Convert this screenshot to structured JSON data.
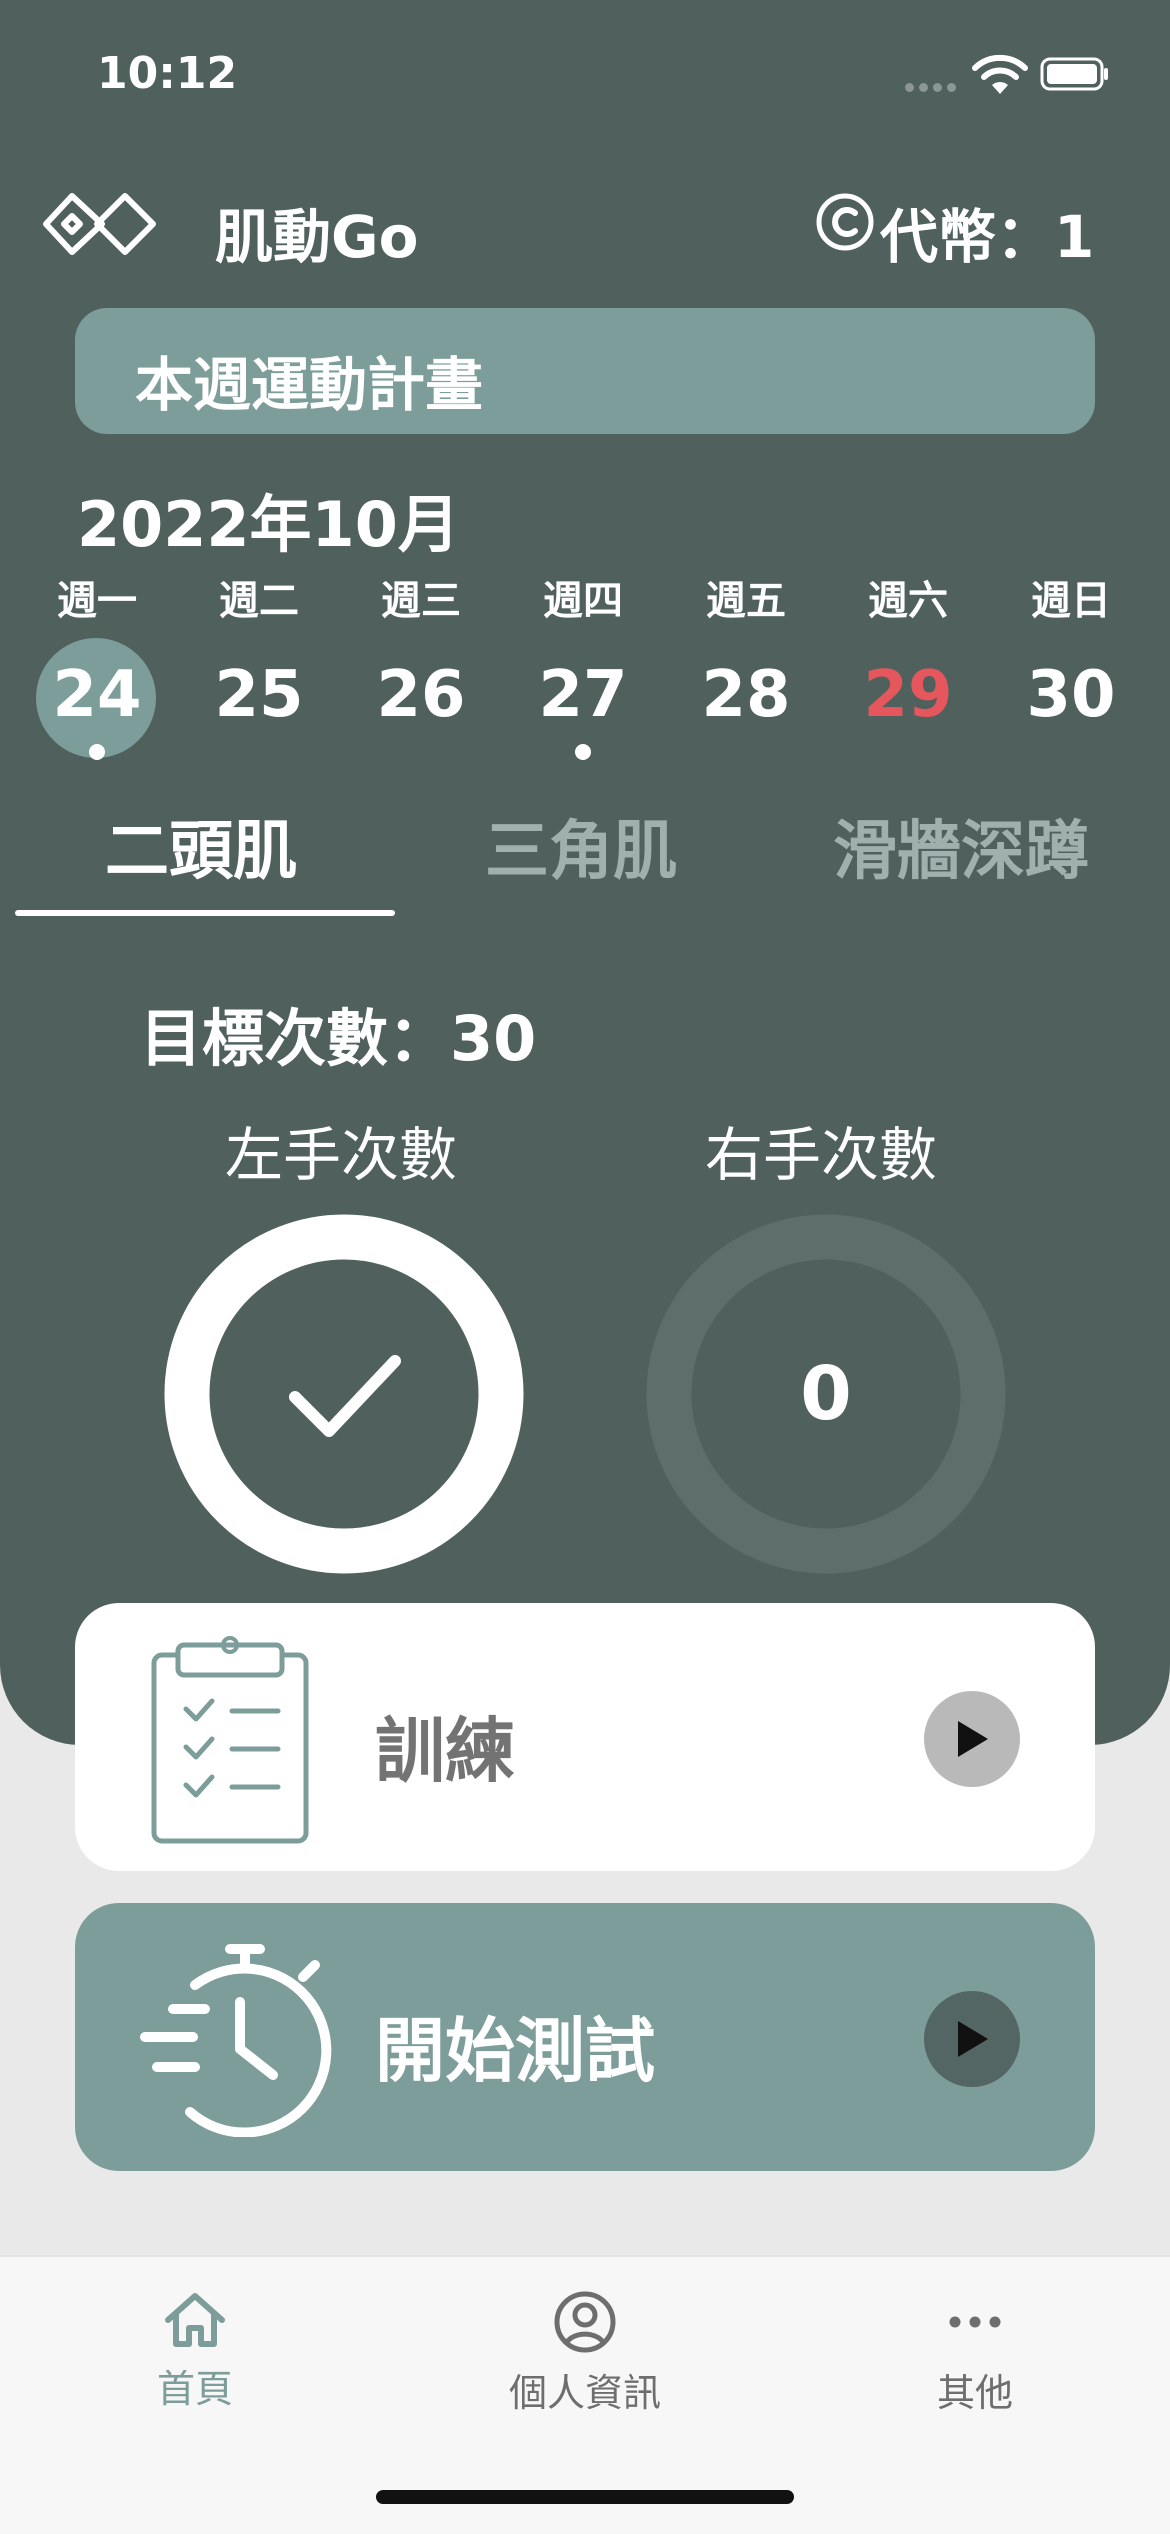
{
  "status_bar": {
    "time": "10:12"
  },
  "header": {
    "app_title": "肌動Go",
    "coins": "代幣：1"
  },
  "plan": {
    "title": "本週運動計畫"
  },
  "calendar": {
    "month": "2022年10月",
    "days": [
      {
        "dow": "週一",
        "date": "24",
        "selected": true,
        "has_dot": true
      },
      {
        "dow": "週二",
        "date": "25"
      },
      {
        "dow": "週三",
        "date": "26"
      },
      {
        "dow": "週四",
        "date": "27",
        "has_dot": true
      },
      {
        "dow": "週五",
        "date": "28"
      },
      {
        "dow": "週六",
        "date": "29",
        "highlight_color": "#e5575c"
      },
      {
        "dow": "週日",
        "date": "30"
      }
    ]
  },
  "tabs": [
    {
      "label": "二頭肌",
      "active": true
    },
    {
      "label": "三角肌"
    },
    {
      "label": "滑牆深蹲"
    }
  ],
  "exercise": {
    "target": "目標次數：30",
    "left_label": "左手次數",
    "right_label": "右手次數",
    "left_status": "completed",
    "right_count": "0"
  },
  "cards": {
    "train": {
      "label": "訓練",
      "icon": "clipboard-checklist-icon"
    },
    "test": {
      "label": "開始測試",
      "icon": "stopwatch-icon"
    }
  },
  "bottom_nav": [
    {
      "label": "首頁",
      "icon": "home-icon",
      "active": true
    },
    {
      "label": "個人資訊",
      "icon": "user-circle-icon"
    },
    {
      "label": "其他",
      "icon": "more-icon"
    }
  ],
  "colors": {
    "panel": "#4f605d",
    "accent": "#7d9d9a",
    "weekend_red": "#e5575c",
    "nav_active": "#7d9d9a",
    "nav_inactive": "#6e6e6e"
  }
}
